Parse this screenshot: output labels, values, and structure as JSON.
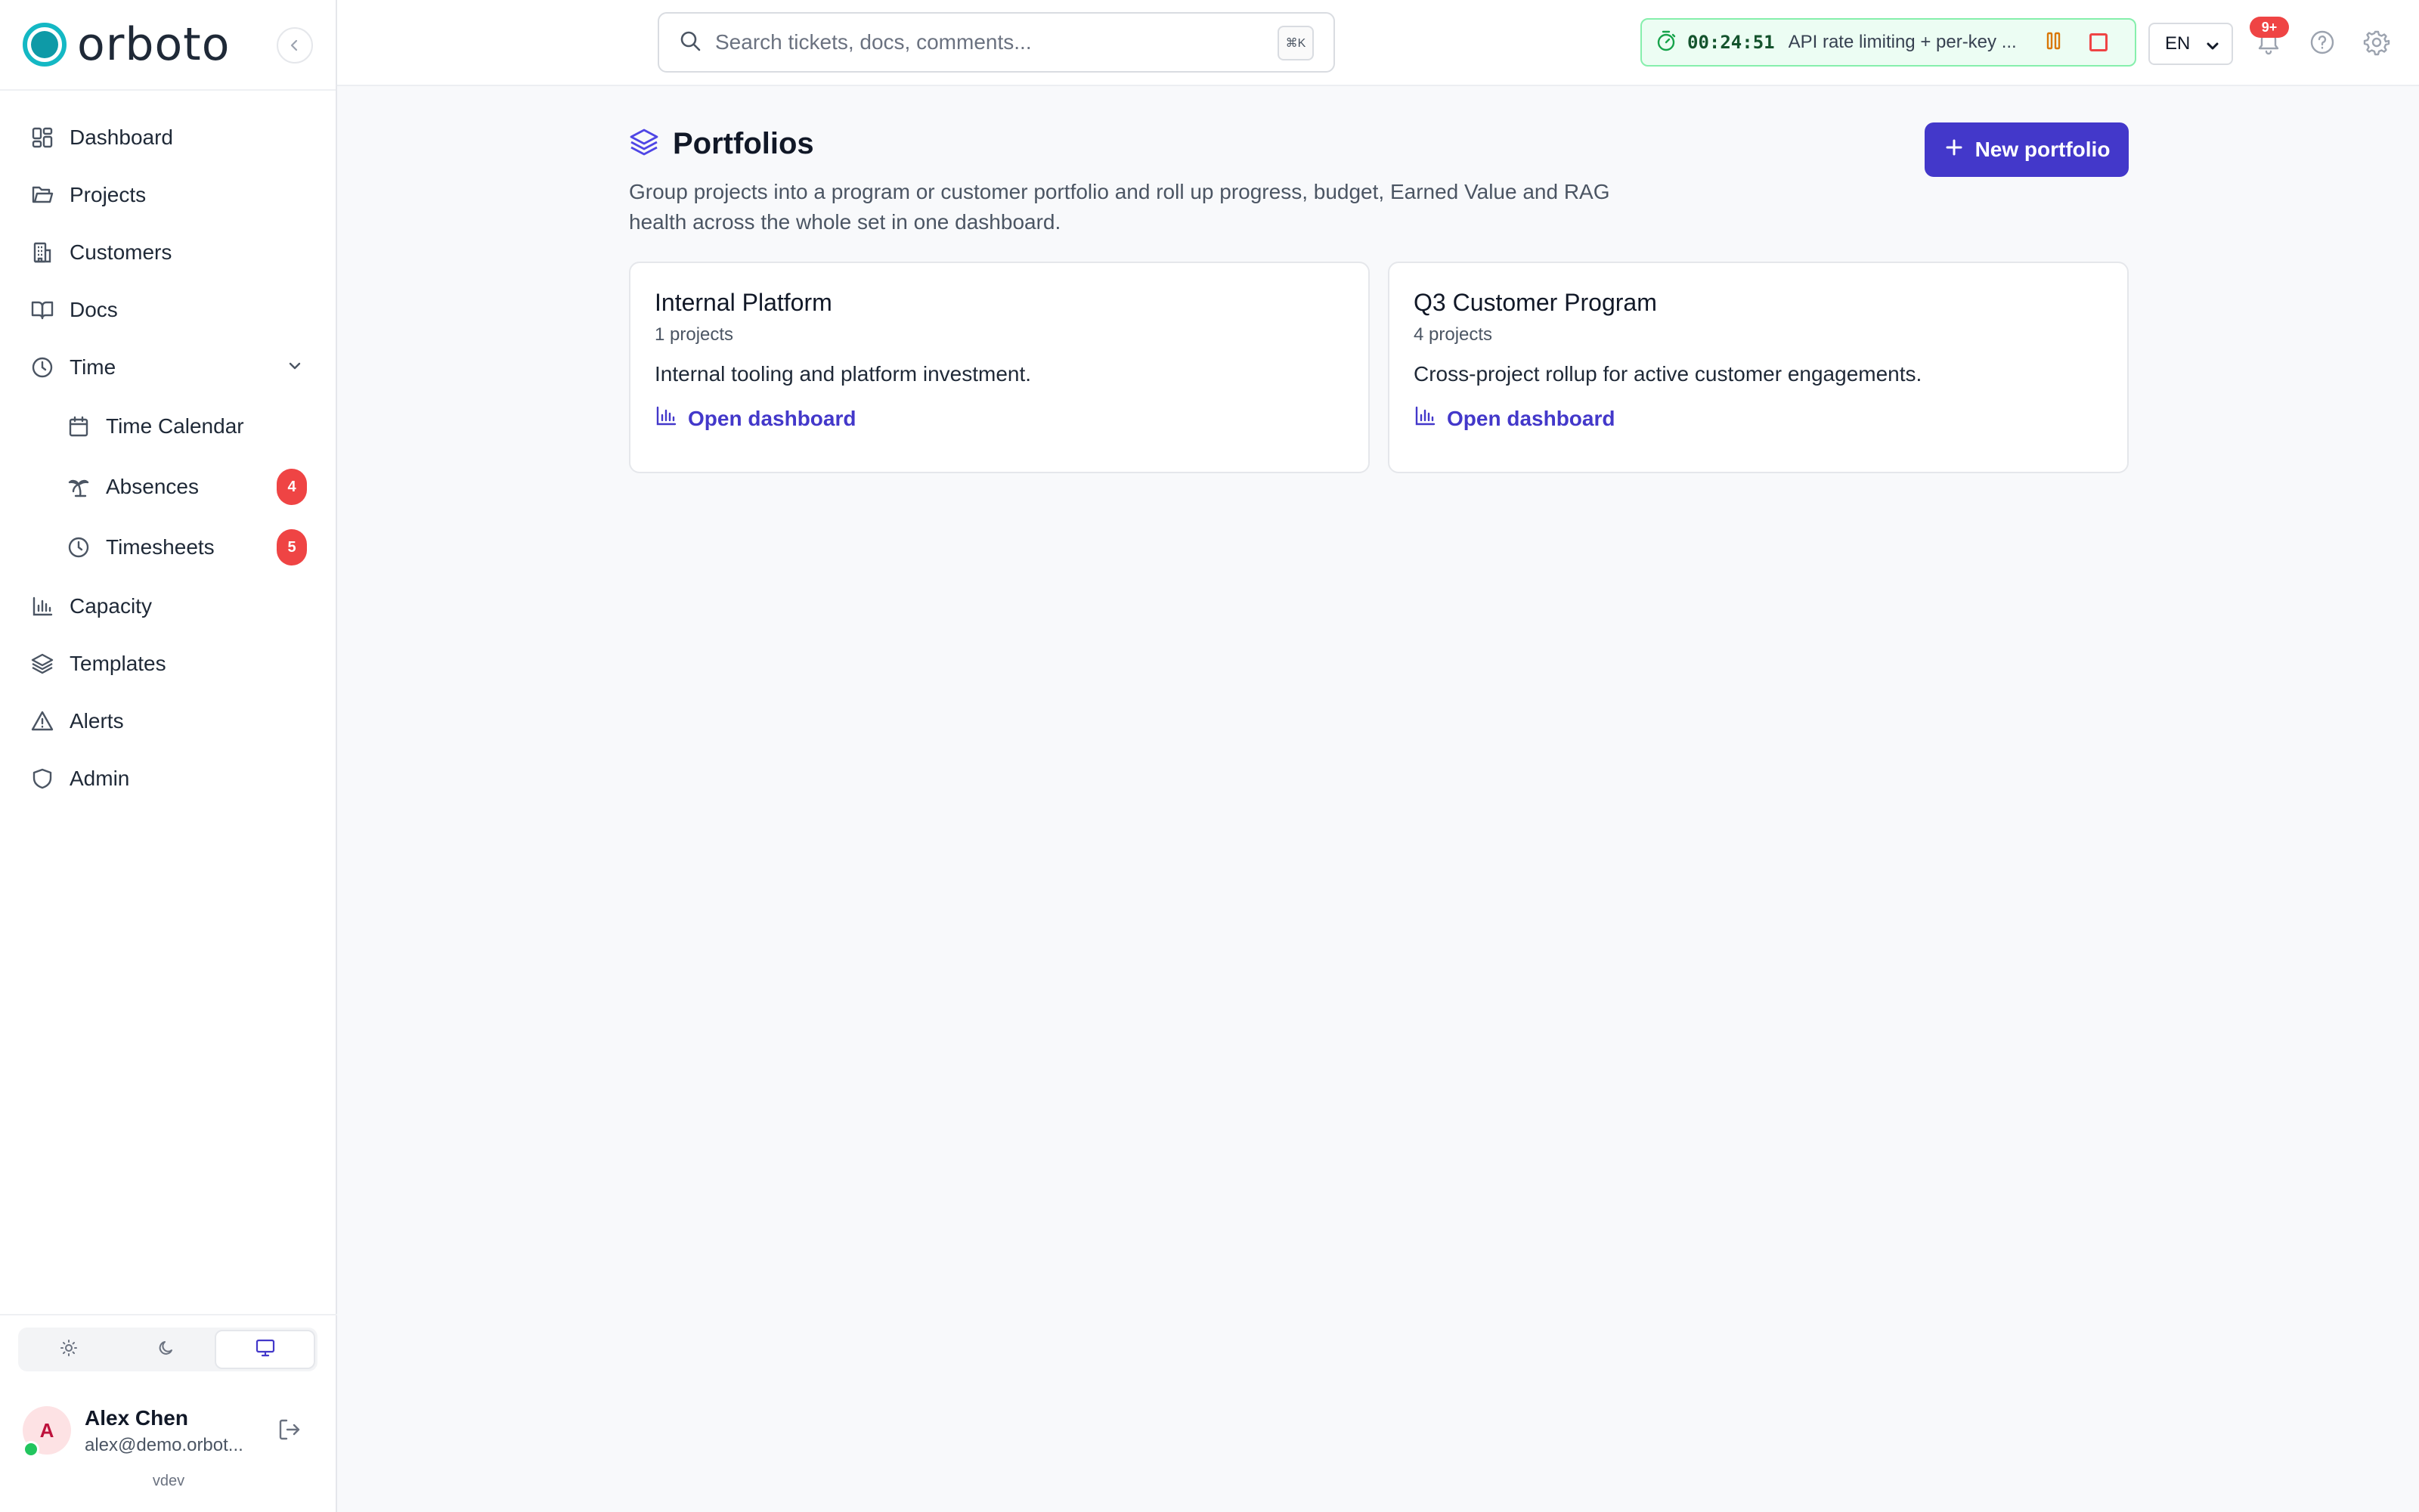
{
  "app": {
    "brand": "orboto",
    "version": "vdev"
  },
  "sidebar": {
    "items": [
      {
        "label": "Dashboard",
        "icon": "dashboard-grid-icon"
      },
      {
        "label": "Projects",
        "icon": "folder-icon"
      },
      {
        "label": "Customers",
        "icon": "building-icon"
      },
      {
        "label": "Docs",
        "icon": "book-icon"
      },
      {
        "label": "Time",
        "icon": "clock-icon"
      },
      {
        "label": "Time Calendar",
        "icon": "calendar-icon"
      },
      {
        "label": "Absences",
        "icon": "palm-tree-icon",
        "badge": "4"
      },
      {
        "label": "Timesheets",
        "icon": "clock-icon",
        "badge": "5"
      },
      {
        "label": "Capacity",
        "icon": "bar-chart-icon"
      },
      {
        "label": "Templates",
        "icon": "layers-icon"
      },
      {
        "label": "Alerts",
        "icon": "warning-icon"
      },
      {
        "label": "Admin",
        "icon": "shield-icon"
      }
    ],
    "theme_active": "system"
  },
  "user": {
    "initial": "A",
    "name": "Alex Chen",
    "email": "alex@demo.orbot..."
  },
  "topbar": {
    "search_placeholder": "Search tickets, docs, comments...",
    "search_shortcut": "⌘K",
    "timer_time": "00:24:51",
    "timer_task": "API rate limiting + per-key ...",
    "language": "EN",
    "notifications_badge": "9+"
  },
  "page": {
    "title": "Portfolios",
    "description": "Group projects into a program or customer portfolio and roll up progress, budget, Earned Value and RAG health across the whole set in one dashboard.",
    "new_button": "New portfolio"
  },
  "portfolios": [
    {
      "name": "Internal Platform",
      "count": "1 projects",
      "description": "Internal tooling and platform investment.",
      "link": "Open dashboard"
    },
    {
      "name": "Q3 Customer Program",
      "count": "4 projects",
      "description": "Cross-project rollup for active customer engagements.",
      "link": "Open dashboard"
    }
  ],
  "colors": {
    "accent": "#4338ca",
    "brand": "#14b8c4",
    "badge": "#ef4444",
    "timer_bg": "#ecfdf3"
  }
}
